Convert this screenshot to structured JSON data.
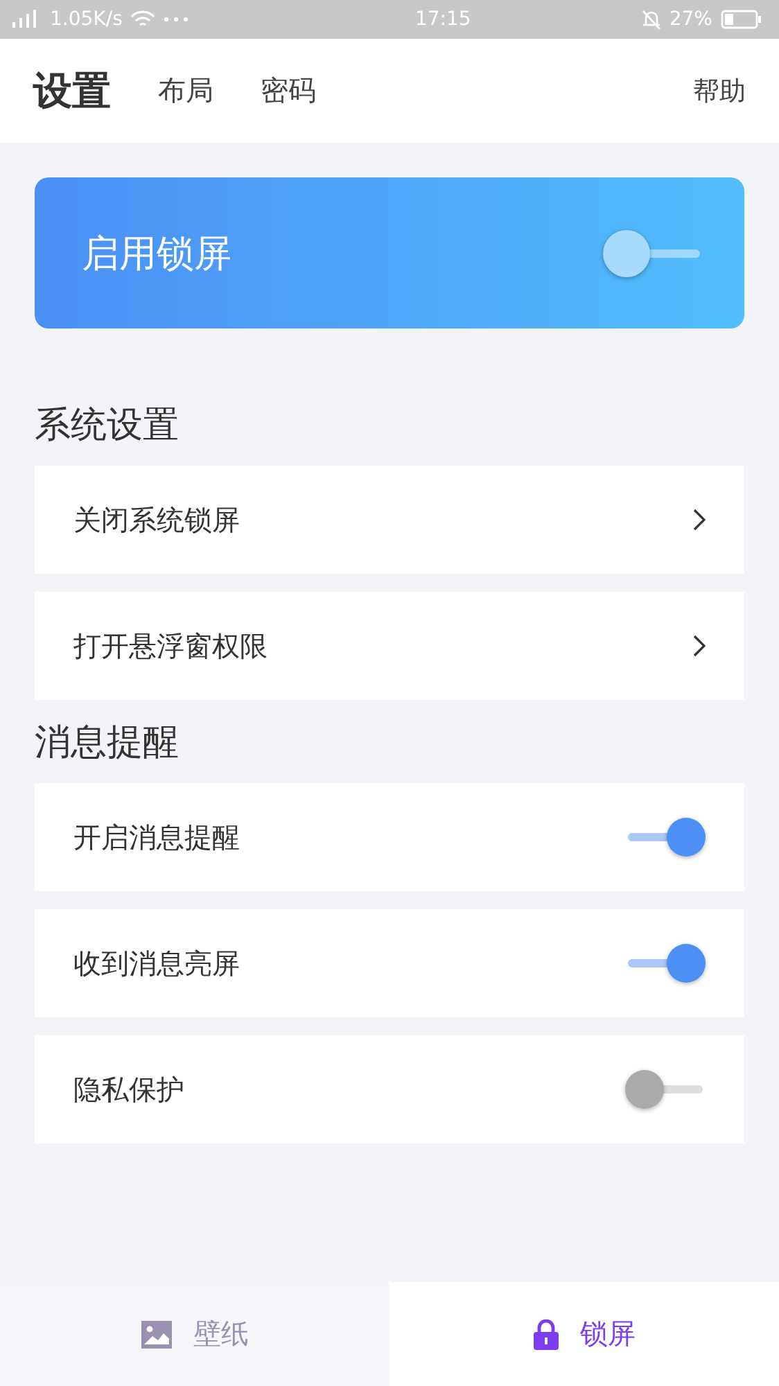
{
  "status_bar": {
    "speed": "1.05K/s",
    "time": "17:15",
    "battery": "27%"
  },
  "tabs": [
    {
      "label": "设置",
      "selected": true
    },
    {
      "label": "布局",
      "selected": false
    },
    {
      "label": "密码",
      "selected": false
    }
  ],
  "help": "帮助",
  "banner": {
    "label": "启用锁屏",
    "on": false
  },
  "sections": [
    {
      "title": "系统设置",
      "rows": [
        {
          "kind": "link",
          "label": "关闭系统锁屏"
        },
        {
          "kind": "link",
          "label": "打开悬浮窗权限"
        }
      ]
    },
    {
      "title": "消息提醒",
      "rows": [
        {
          "kind": "toggle",
          "label": "开启消息提醒",
          "on": true
        },
        {
          "kind": "toggle",
          "label": "收到消息亮屏",
          "on": true
        },
        {
          "kind": "toggle",
          "label": "隐私保护",
          "on": false
        }
      ]
    }
  ],
  "bottom_nav": [
    {
      "kind": "image",
      "label": "壁纸",
      "selected": false
    },
    {
      "kind": "lock",
      "label": "锁屏",
      "selected": true
    }
  ]
}
